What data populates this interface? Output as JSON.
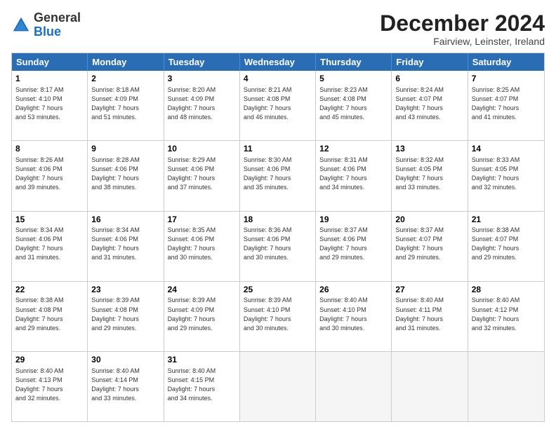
{
  "header": {
    "logo_general": "General",
    "logo_blue": "Blue",
    "month_title": "December 2024",
    "location": "Fairview, Leinster, Ireland"
  },
  "days_of_week": [
    "Sunday",
    "Monday",
    "Tuesday",
    "Wednesday",
    "Thursday",
    "Friday",
    "Saturday"
  ],
  "weeks": [
    [
      {
        "day": "1",
        "info": "Sunrise: 8:17 AM\nSunset: 4:10 PM\nDaylight: 7 hours\nand 53 minutes."
      },
      {
        "day": "2",
        "info": "Sunrise: 8:18 AM\nSunset: 4:09 PM\nDaylight: 7 hours\nand 51 minutes."
      },
      {
        "day": "3",
        "info": "Sunrise: 8:20 AM\nSunset: 4:09 PM\nDaylight: 7 hours\nand 48 minutes."
      },
      {
        "day": "4",
        "info": "Sunrise: 8:21 AM\nSunset: 4:08 PM\nDaylight: 7 hours\nand 46 minutes."
      },
      {
        "day": "5",
        "info": "Sunrise: 8:23 AM\nSunset: 4:08 PM\nDaylight: 7 hours\nand 45 minutes."
      },
      {
        "day": "6",
        "info": "Sunrise: 8:24 AM\nSunset: 4:07 PM\nDaylight: 7 hours\nand 43 minutes."
      },
      {
        "day": "7",
        "info": "Sunrise: 8:25 AM\nSunset: 4:07 PM\nDaylight: 7 hours\nand 41 minutes."
      }
    ],
    [
      {
        "day": "8",
        "info": "Sunrise: 8:26 AM\nSunset: 4:06 PM\nDaylight: 7 hours\nand 39 minutes."
      },
      {
        "day": "9",
        "info": "Sunrise: 8:28 AM\nSunset: 4:06 PM\nDaylight: 7 hours\nand 38 minutes."
      },
      {
        "day": "10",
        "info": "Sunrise: 8:29 AM\nSunset: 4:06 PM\nDaylight: 7 hours\nand 37 minutes."
      },
      {
        "day": "11",
        "info": "Sunrise: 8:30 AM\nSunset: 4:06 PM\nDaylight: 7 hours\nand 35 minutes."
      },
      {
        "day": "12",
        "info": "Sunrise: 8:31 AM\nSunset: 4:06 PM\nDaylight: 7 hours\nand 34 minutes."
      },
      {
        "day": "13",
        "info": "Sunrise: 8:32 AM\nSunset: 4:05 PM\nDaylight: 7 hours\nand 33 minutes."
      },
      {
        "day": "14",
        "info": "Sunrise: 8:33 AM\nSunset: 4:05 PM\nDaylight: 7 hours\nand 32 minutes."
      }
    ],
    [
      {
        "day": "15",
        "info": "Sunrise: 8:34 AM\nSunset: 4:06 PM\nDaylight: 7 hours\nand 31 minutes."
      },
      {
        "day": "16",
        "info": "Sunrise: 8:34 AM\nSunset: 4:06 PM\nDaylight: 7 hours\nand 31 minutes."
      },
      {
        "day": "17",
        "info": "Sunrise: 8:35 AM\nSunset: 4:06 PM\nDaylight: 7 hours\nand 30 minutes."
      },
      {
        "day": "18",
        "info": "Sunrise: 8:36 AM\nSunset: 4:06 PM\nDaylight: 7 hours\nand 30 minutes."
      },
      {
        "day": "19",
        "info": "Sunrise: 8:37 AM\nSunset: 4:06 PM\nDaylight: 7 hours\nand 29 minutes."
      },
      {
        "day": "20",
        "info": "Sunrise: 8:37 AM\nSunset: 4:07 PM\nDaylight: 7 hours\nand 29 minutes."
      },
      {
        "day": "21",
        "info": "Sunrise: 8:38 AM\nSunset: 4:07 PM\nDaylight: 7 hours\nand 29 minutes."
      }
    ],
    [
      {
        "day": "22",
        "info": "Sunrise: 8:38 AM\nSunset: 4:08 PM\nDaylight: 7 hours\nand 29 minutes."
      },
      {
        "day": "23",
        "info": "Sunrise: 8:39 AM\nSunset: 4:08 PM\nDaylight: 7 hours\nand 29 minutes."
      },
      {
        "day": "24",
        "info": "Sunrise: 8:39 AM\nSunset: 4:09 PM\nDaylight: 7 hours\nand 29 minutes."
      },
      {
        "day": "25",
        "info": "Sunrise: 8:39 AM\nSunset: 4:10 PM\nDaylight: 7 hours\nand 30 minutes."
      },
      {
        "day": "26",
        "info": "Sunrise: 8:40 AM\nSunset: 4:10 PM\nDaylight: 7 hours\nand 30 minutes."
      },
      {
        "day": "27",
        "info": "Sunrise: 8:40 AM\nSunset: 4:11 PM\nDaylight: 7 hours\nand 31 minutes."
      },
      {
        "day": "28",
        "info": "Sunrise: 8:40 AM\nSunset: 4:12 PM\nDaylight: 7 hours\nand 32 minutes."
      }
    ],
    [
      {
        "day": "29",
        "info": "Sunrise: 8:40 AM\nSunset: 4:13 PM\nDaylight: 7 hours\nand 32 minutes."
      },
      {
        "day": "30",
        "info": "Sunrise: 8:40 AM\nSunset: 4:14 PM\nDaylight: 7 hours\nand 33 minutes."
      },
      {
        "day": "31",
        "info": "Sunrise: 8:40 AM\nSunset: 4:15 PM\nDaylight: 7 hours\nand 34 minutes."
      },
      {
        "day": "",
        "info": ""
      },
      {
        "day": "",
        "info": ""
      },
      {
        "day": "",
        "info": ""
      },
      {
        "day": "",
        "info": ""
      }
    ]
  ]
}
